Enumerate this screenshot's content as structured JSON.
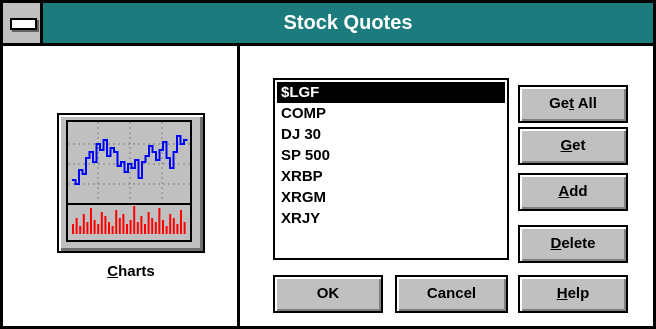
{
  "window": {
    "title": "Stock Quotes",
    "title_bar_color": "#1c7b7c",
    "sys_menu_icon": "system-menu-icon"
  },
  "charts": {
    "icon": "stock-chart-icon",
    "label_pre": "",
    "label_mnemonic": "C",
    "label_post": "harts",
    "line_color": "#0000ff",
    "bar_color": "#ff0000"
  },
  "quotes_list": {
    "items": [
      "$LGF",
      "COMP",
      "DJ 30",
      "SP 500",
      "XRBP",
      "XRGM",
      "XRJY"
    ],
    "selected": "$LGF"
  },
  "buttons": {
    "get_all": {
      "pre": "Ge",
      "mnemonic": "t",
      "post": " All"
    },
    "get": {
      "pre": "",
      "mnemonic": "G",
      "post": "et"
    },
    "add": {
      "pre": "",
      "mnemonic": "A",
      "post": "dd"
    },
    "delete": {
      "pre": "",
      "mnemonic": "D",
      "post": "elete"
    },
    "ok": {
      "label": "OK"
    },
    "cancel": {
      "label": "Cancel"
    },
    "help": {
      "pre": "",
      "mnemonic": "H",
      "post": "elp"
    }
  }
}
